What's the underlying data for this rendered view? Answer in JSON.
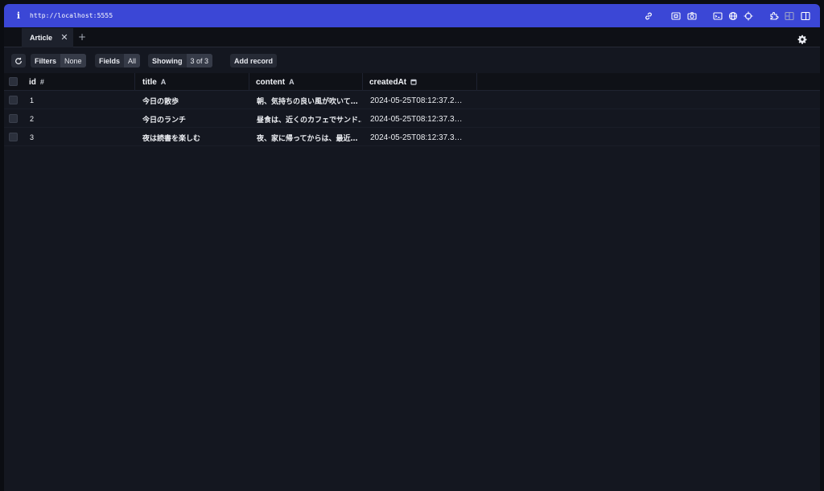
{
  "address_bar": {
    "url": "http://localhost:5555"
  },
  "tabs": [
    {
      "label": "Article",
      "active": true
    }
  ],
  "toolbar": {
    "filters_label": "Filters",
    "filters_value": "None",
    "fields_label": "Fields",
    "fields_value": "All",
    "showing_label": "Showing",
    "showing_value": "3 of 3",
    "add_record_label": "Add record"
  },
  "table": {
    "columns": [
      {
        "name": "id",
        "type_icon": "#"
      },
      {
        "name": "title",
        "type_icon": "A"
      },
      {
        "name": "content",
        "type_icon": "A"
      },
      {
        "name": "createdAt",
        "type_icon": "calendar-icon"
      }
    ],
    "rows": [
      {
        "id": "1",
        "title": "今日の散歩",
        "content": "朝、気持ちの良い風が吹いて…",
        "createdAt": "2024-05-25T08:12:37.2…"
      },
      {
        "id": "2",
        "title": "今日のランチ",
        "content": "昼食は、近くのカフェでサンド…",
        "createdAt": "2024-05-25T08:12:37.3…"
      },
      {
        "id": "3",
        "title": "夜は読書を楽しむ",
        "content": "夜、家に帰ってからは、最近…",
        "createdAt": "2024-05-25T08:12:37.3…"
      }
    ]
  },
  "colors": {
    "address_bar": "#3b47d6",
    "background": "#141720",
    "header": "#0f1117"
  }
}
